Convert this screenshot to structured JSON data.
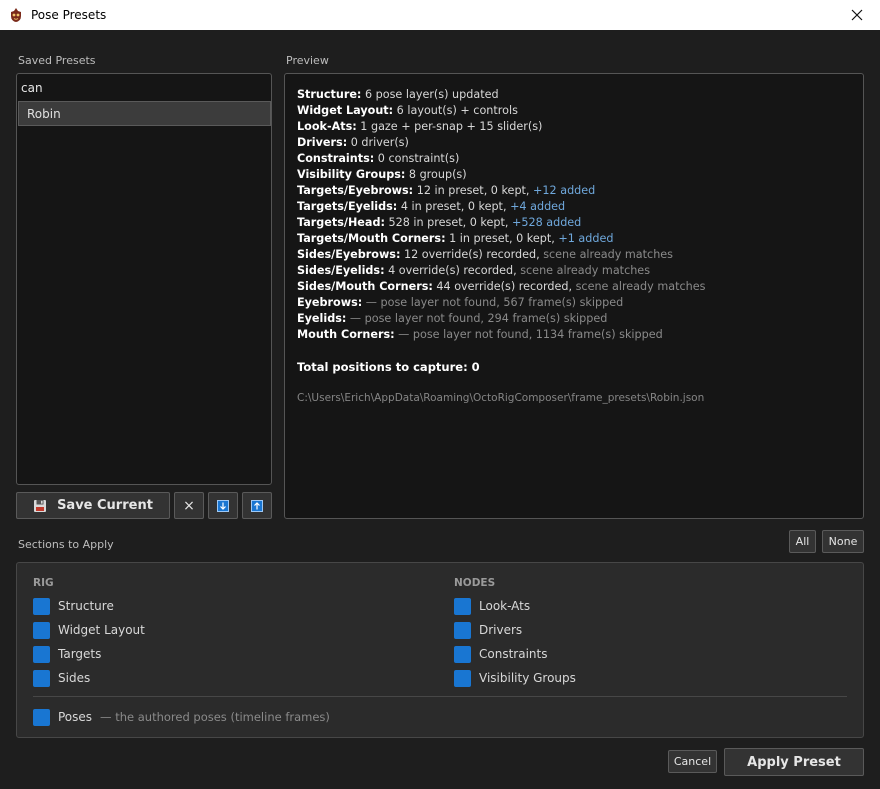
{
  "window": {
    "title": "Pose Presets"
  },
  "saved_presets": {
    "label": "Saved Presets",
    "search_value": "can",
    "items": [
      {
        "label": "Robin"
      }
    ]
  },
  "buttons": {
    "save_current": "Save Current",
    "delete_glyph": "×",
    "all": "All",
    "none": "None",
    "cancel": "Cancel",
    "apply": "Apply Preset"
  },
  "preview": {
    "label": "Preview",
    "lines": [
      {
        "key": "Structure:",
        "text": " 6 pose layer(s) updated",
        "extra": "",
        "extra_kind": ""
      },
      {
        "key": "Widget Layout:",
        "text": " 6 layout(s) + controls",
        "extra": "",
        "extra_kind": ""
      },
      {
        "key": "Look-Ats:",
        "text": " 1 gaze + per-snap + 15 slider(s)",
        "extra": "",
        "extra_kind": ""
      },
      {
        "key": "Drivers:",
        "text": " 0 driver(s)",
        "extra": "",
        "extra_kind": ""
      },
      {
        "key": "Constraints:",
        "text": " 0 constraint(s)",
        "extra": "",
        "extra_kind": ""
      },
      {
        "key": "Visibility Groups:",
        "text": " 8 group(s)",
        "extra": "",
        "extra_kind": ""
      },
      {
        "key": "Targets/Eyebrows:",
        "text": " 12 in preset, 0 kept, ",
        "extra": "+12 added",
        "extra_kind": "added"
      },
      {
        "key": "Targets/Eyelids:",
        "text": " 4 in preset, 0 kept, ",
        "extra": "+4 added",
        "extra_kind": "added"
      },
      {
        "key": "Targets/Head:",
        "text": " 528 in preset, 0 kept, ",
        "extra": "+528 added",
        "extra_kind": "added"
      },
      {
        "key": "Targets/Mouth Corners:",
        "text": " 1 in preset, 0 kept, ",
        "extra": "+1 added",
        "extra_kind": "added"
      },
      {
        "key": "Sides/Eyebrows:",
        "text": " 12 override(s) recorded, ",
        "extra": "scene already matches",
        "extra_kind": "muted"
      },
      {
        "key": "Sides/Eyelids:",
        "text": " 4 override(s) recorded, ",
        "extra": "scene already matches",
        "extra_kind": "muted"
      },
      {
        "key": "Sides/Mouth Corners:",
        "text": " 44 override(s) recorded, ",
        "extra": "scene already matches",
        "extra_kind": "muted"
      },
      {
        "key": "Eyebrows:",
        "text": "",
        "extra": " — pose layer not found, 567 frame(s) skipped",
        "extra_kind": "muted"
      },
      {
        "key": "Eyelids:",
        "text": "",
        "extra": " — pose layer not found, 294 frame(s) skipped",
        "extra_kind": "muted"
      },
      {
        "key": "Mouth Corners:",
        "text": "",
        "extra": " — pose layer not found, 1134 frame(s) skipped",
        "extra_kind": "muted"
      }
    ],
    "total": "Total positions to capture: 0",
    "path": "C:\\Users\\Erich\\AppData\\Roaming\\OctoRigComposer\\frame_presets\\Robin.json"
  },
  "sections": {
    "label": "Sections to Apply",
    "rig_header": "RIG",
    "nodes_header": "NODES",
    "rig_items": [
      "Structure",
      "Widget Layout",
      "Targets",
      "Sides"
    ],
    "nodes_items": [
      "Look-Ats",
      "Drivers",
      "Constraints",
      "Visibility Groups"
    ],
    "poses_label": "Poses",
    "poses_hint": "— the authored poses (timeline frames)"
  },
  "colors": {
    "accent": "#1976d2",
    "added": "#6fa8dc",
    "background": "#1e1e1e"
  },
  "icons": {
    "app": "mask-icon",
    "close": "close-icon",
    "save": "floppy-disk-icon",
    "import": "arrow-down-icon",
    "export": "arrow-up-icon"
  }
}
